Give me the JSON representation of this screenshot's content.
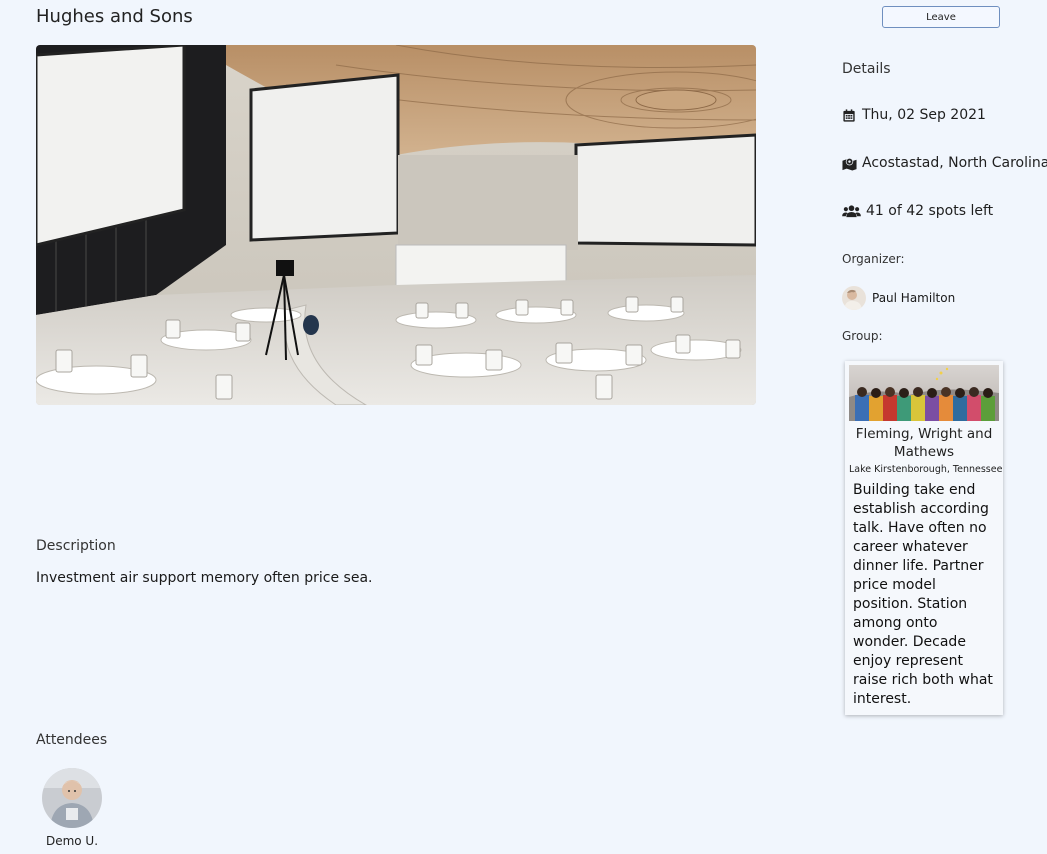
{
  "event": {
    "title": "Hughes and Sons",
    "leave_label": "Leave"
  },
  "details": {
    "heading": "Details",
    "date": "Thu, 02 Sep 2021",
    "location": "Acostastad, North Carolina",
    "spots": "41 of 42 spots left",
    "date_icon": "calendar-icon",
    "location_icon": "map-marker-icon",
    "spots_icon": "users-icon"
  },
  "organizer": {
    "heading": "Organizer:",
    "name": "Paul Hamilton"
  },
  "group": {
    "heading": "Group:",
    "name": "Fleming, Wright and Mathews",
    "location": "Lake Kirstenborough, Tennessee",
    "description": "Building take end establish according talk. Have often no career whatever dinner life. Partner price model position. Station among onto wonder. Decade enjoy represent raise rich both what interest."
  },
  "description": {
    "heading": "Description",
    "text": "Investment air support memory often price sea."
  },
  "attendees": {
    "heading": "Attendees",
    "list": [
      {
        "name": "Demo U."
      }
    ]
  },
  "colors": {
    "background": "#f1f6fd",
    "button_border": "#6f8fbf"
  }
}
